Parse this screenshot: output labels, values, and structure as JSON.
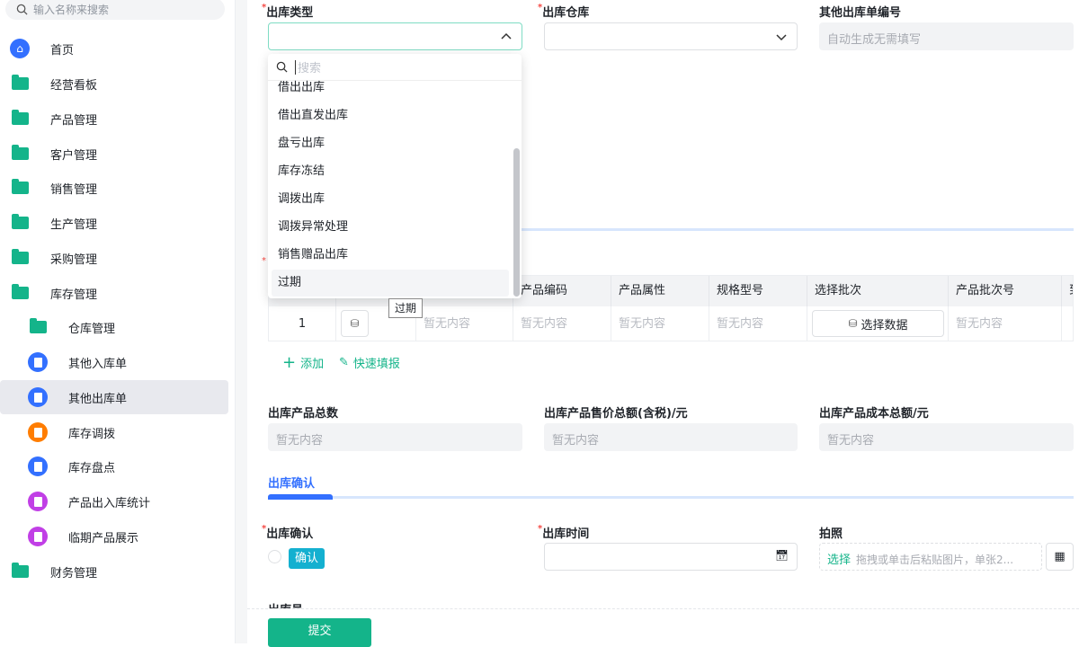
{
  "sidebar": {
    "search_placeholder": "输入名称来搜索",
    "items": [
      {
        "label": "首页",
        "icon": "home-icon"
      },
      {
        "label": "经营看板",
        "icon": "folder-icon"
      },
      {
        "label": "产品管理",
        "icon": "folder-icon"
      },
      {
        "label": "客户管理",
        "icon": "folder-icon"
      },
      {
        "label": "销售管理",
        "icon": "folder-icon"
      },
      {
        "label": "生产管理",
        "icon": "folder-icon"
      },
      {
        "label": "采购管理",
        "icon": "folder-icon"
      },
      {
        "label": "库存管理",
        "icon": "folder-open-icon"
      },
      {
        "label": "仓库管理",
        "icon": "folder-icon"
      },
      {
        "label": "其他入库单",
        "icon": "document-icon",
        "color": "#3370ff"
      },
      {
        "label": "其他出库单",
        "icon": "document-icon",
        "color": "#3370ff",
        "active": true
      },
      {
        "label": "库存调拨",
        "icon": "transfer-icon",
        "color": "#ff7d00"
      },
      {
        "label": "库存盘点",
        "icon": "document-icon",
        "color": "#3370ff"
      },
      {
        "label": "产品出入库统计",
        "icon": "chart-screen-icon",
        "color": "#c13fe6"
      },
      {
        "label": "临期产品展示",
        "icon": "chart-screen-icon",
        "color": "#c13fe6"
      },
      {
        "label": "财务管理",
        "icon": "folder-icon"
      }
    ]
  },
  "form": {
    "type_label": "出库类型",
    "warehouse_label": "出库仓库",
    "number_label": "其他出库单编号",
    "number_placeholder": "自动生成无需填写",
    "dropdown": {
      "search_placeholder": "搜索",
      "options": [
        "借出出库",
        "借出直发出库",
        "盘亏出库",
        "库存冻结",
        "调拨出库",
        "调拨异常处理",
        "销售赠品出库",
        "过期"
      ],
      "hovered": "过期",
      "tooltip": "过期"
    },
    "table": {
      "headers": [
        "产品编码",
        "产品属性",
        "规格型号",
        "选择批次",
        "产品批次号",
        "到"
      ],
      "row": {
        "index": "1",
        "empty": "暂无内容",
        "select_batch": "选择数据"
      }
    },
    "add_label": "添加",
    "quick_fill_label": "快速填报",
    "total_qty_label": "出库产品总数",
    "total_price_label": "出库产品售价总额(含税)/元",
    "total_cost_label": "出库产品成本总额/元",
    "empty": "暂无内容",
    "section_tab": "出库确认",
    "confirm_label": "出库确认",
    "confirm_tag": "确认",
    "time_label": "出库时间",
    "photo_label": "拍照",
    "photo_select": "选择",
    "photo_hint": "拖拽或单击后粘贴图片，单张2...",
    "operator_label": "出库员",
    "submit": "提交"
  },
  "colors": {
    "accent": "#14b48a",
    "blue": "#3370ff"
  }
}
